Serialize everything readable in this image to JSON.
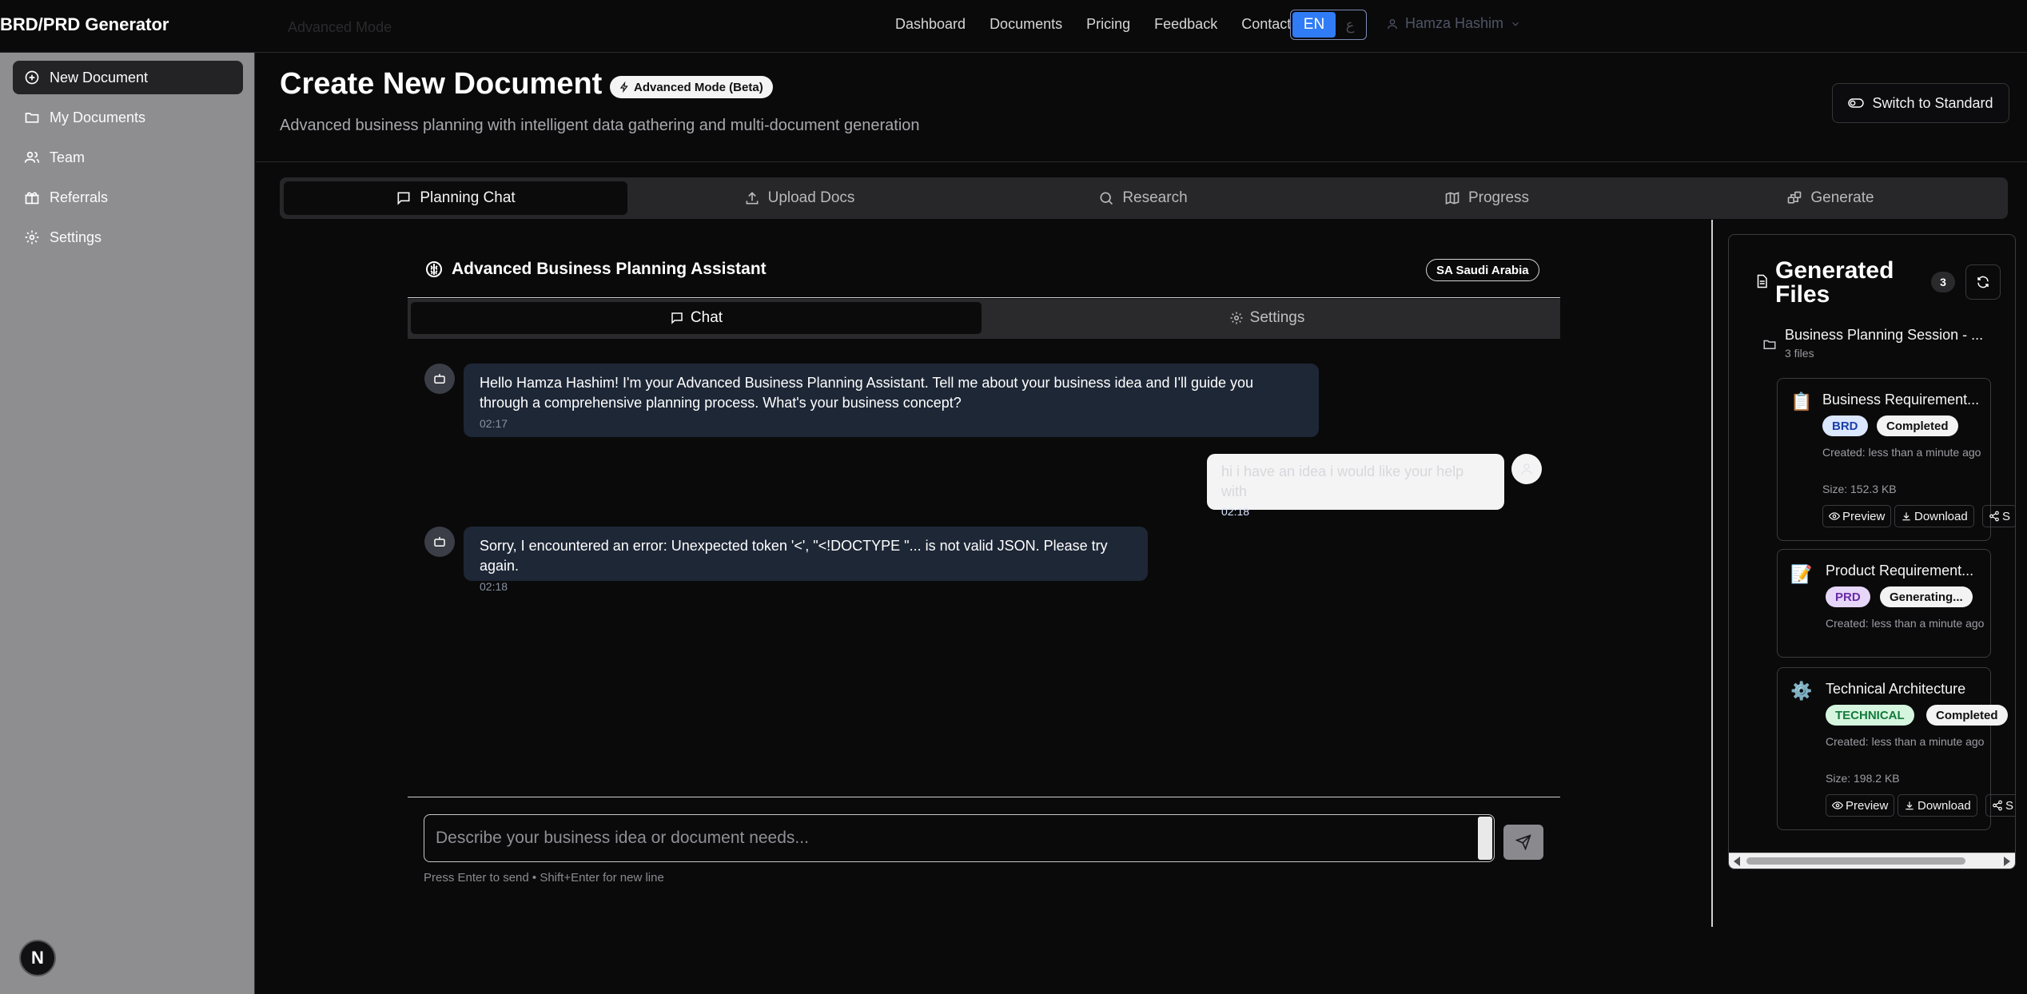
{
  "app": {
    "brand": "BRD/PRD Generator",
    "brand_ghost": "Advanced Mode"
  },
  "nav": {
    "items": [
      "Dashboard",
      "Documents",
      "Pricing",
      "Feedback",
      "Contact"
    ],
    "lang_en": "EN",
    "lang_ar": "ع",
    "user_name": "Hamza Hashim"
  },
  "sidebar": {
    "items": [
      {
        "label": "New Document",
        "icon": "plus-circle-icon",
        "active": true
      },
      {
        "label": "My Documents",
        "icon": "folder-icon"
      },
      {
        "label": "Team",
        "icon": "users-icon"
      },
      {
        "label": "Referrals",
        "icon": "gift-icon"
      },
      {
        "label": "Settings",
        "icon": "gear-icon"
      }
    ],
    "badge": "N"
  },
  "header": {
    "title": "Create New Document",
    "mode_badge": "Advanced Mode (Beta)",
    "subtitle": "Advanced business planning with intelligent data gathering and multi-document generation",
    "switch_label": "Switch to Standard"
  },
  "tabs": [
    "Planning Chat",
    "Upload Docs",
    "Research",
    "Progress",
    "Generate"
  ],
  "chat": {
    "title": "Advanced Business Planning Assistant",
    "region": "SA Saudi Arabia",
    "subtabs": [
      "Chat",
      "Settings"
    ],
    "messages": [
      {
        "role": "assistant",
        "text": "Hello Hamza Hashim! I'm your Advanced Business Planning Assistant. Tell me about your business idea and I'll guide you through a comprehensive planning process. What's your business concept?",
        "time": "02:17"
      },
      {
        "role": "user",
        "text": "hi i have an idea i would like your help with",
        "time": "02:18"
      },
      {
        "role": "assistant",
        "text": "Sorry, I encountered an error: Unexpected token '<', \"<!DOCTYPE \"... is not valid JSON. Please try again.",
        "time": "02:18"
      }
    ],
    "input_placeholder": "Describe your business idea or document needs...",
    "hint": "Press Enter to send • Shift+Enter for new line"
  },
  "files": {
    "title": "Generated Files",
    "count": "3",
    "session_name": "Business Planning Session - ...",
    "session_count": "3 files",
    "cards": [
      {
        "emoji": "📋",
        "name": "Business Requirement...",
        "type": "BRD",
        "status": "Completed",
        "created": "Created: less than a minute ago",
        "size": "Size: 152.3 KB",
        "preview": "Preview",
        "download": "Download",
        "share": "S"
      },
      {
        "emoji": "📝",
        "name": "Product Requirement...",
        "type": "PRD",
        "status": "Generating...",
        "created": "Created: less than a minute ago"
      },
      {
        "emoji": "⚙️",
        "name": "Technical Architecture",
        "type": "TECHNICAL",
        "status": "Completed",
        "created": "Created: less than a minute ago",
        "size": "Size: 198.2 KB",
        "preview": "Preview",
        "download": "Download",
        "share": "S"
      }
    ]
  },
  "colors": {
    "accent": "#2f7cf6",
    "sidebar": "#8e8e90",
    "assistant_bubble": "#1e2736"
  }
}
